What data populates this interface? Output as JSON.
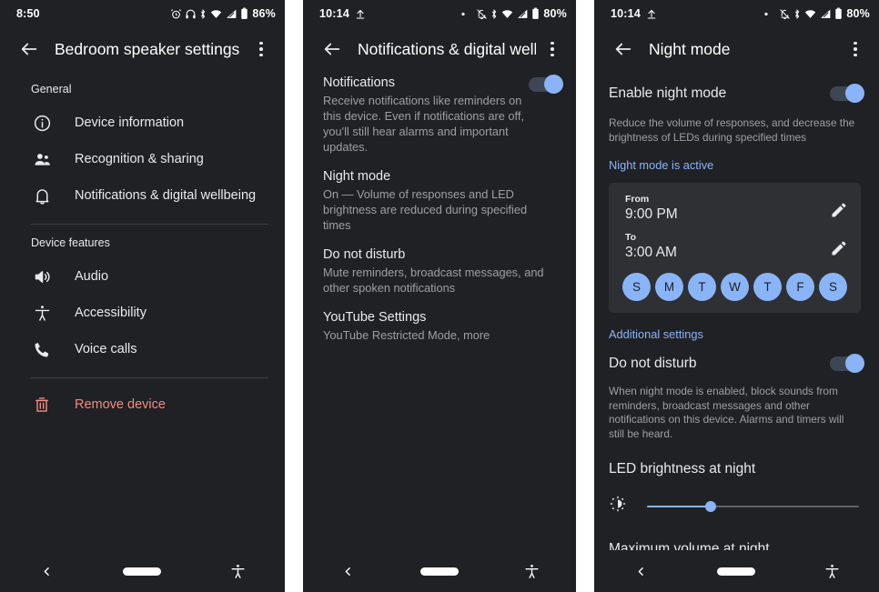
{
  "panels": [
    {
      "id": "bedroom-speaker-settings",
      "status": {
        "time": "8:50",
        "battery": "86%",
        "icons": [
          "alarm-icon",
          "headphones-icon",
          "bluetooth-icon",
          "wifi-icon",
          "signal-icon",
          "battery-icon"
        ]
      },
      "app_bar": {
        "back": "back-arrow-icon",
        "title": "Bedroom speaker settings",
        "overflow": "overflow-menu-icon"
      },
      "sections": [
        {
          "header": "General",
          "items": [
            {
              "icon": "info-circle-icon",
              "label": "Device information"
            },
            {
              "icon": "people-icon",
              "label": "Recognition & sharing"
            },
            {
              "icon": "bell-icon",
              "label": "Notifications & digital wellbeing"
            }
          ]
        },
        {
          "header": "Device features",
          "items": [
            {
              "icon": "speaker-volume-icon",
              "label": "Audio"
            },
            {
              "icon": "accessibility-icon",
              "label": "Accessibility"
            },
            {
              "icon": "phone-icon",
              "label": "Voice calls"
            }
          ]
        }
      ],
      "danger_item": {
        "icon": "trash-icon",
        "label": "Remove device"
      },
      "nav": {
        "back": "nav-back-icon",
        "home": "nav-home-pill",
        "accessibility": "nav-accessibility-icon"
      }
    },
    {
      "id": "notifications-digital-wellbeing",
      "status": {
        "time": "10:14",
        "battery": "80%",
        "icons": [
          "upload-icon",
          "dot-icon",
          "bell-off-icon",
          "bluetooth-icon",
          "wifi-icon",
          "signal-icon",
          "battery-icon"
        ]
      },
      "app_bar": {
        "back": "back-arrow-icon",
        "title": "Notifications & digital well...",
        "overflow": "overflow-menu-icon"
      },
      "prefs": [
        {
          "title": "Notifications",
          "sub": "Receive notifications like reminders on this device. Even if notifications are off, you'll still hear alarms and important updates.",
          "toggle": true
        },
        {
          "title": "Night mode",
          "sub": "On — Volume of responses and LED brightness are reduced during specified times",
          "toggle": false
        },
        {
          "title": "Do not disturb",
          "sub": "Mute reminders, broadcast messages, and other spoken notifications",
          "toggle": false
        },
        {
          "title": "YouTube Settings",
          "sub": "YouTube Restricted Mode, more",
          "toggle": false
        }
      ],
      "nav": {
        "back": "nav-back-icon",
        "home": "nav-home-pill",
        "accessibility": "nav-accessibility-icon"
      }
    },
    {
      "id": "night-mode",
      "status": {
        "time": "10:14",
        "battery": "80%",
        "icons": [
          "upload-icon",
          "dot-icon",
          "bell-off-icon",
          "bluetooth-icon",
          "wifi-icon",
          "signal-icon",
          "battery-icon"
        ]
      },
      "app_bar": {
        "back": "back-arrow-icon",
        "title": "Night mode",
        "overflow": "overflow-menu-icon"
      },
      "enable": {
        "label": "Enable night mode",
        "toggle": true
      },
      "description": "Reduce the volume of responses, and decrease the brightness of LEDs during specified times",
      "status_link": "Night mode is active",
      "schedule": {
        "from_caption": "From",
        "from_value": "9:00 PM",
        "to_caption": "To",
        "to_value": "3:00 AM",
        "edit_icon": "pencil-edit-icon",
        "days": [
          {
            "letter": "S",
            "selected": true
          },
          {
            "letter": "M",
            "selected": true
          },
          {
            "letter": "T",
            "selected": true
          },
          {
            "letter": "W",
            "selected": true
          },
          {
            "letter": "T",
            "selected": true
          },
          {
            "letter": "F",
            "selected": true
          },
          {
            "letter": "S",
            "selected": true
          }
        ]
      },
      "additional_link": "Additional settings",
      "dnd": {
        "label": "Do not disturb",
        "toggle": true,
        "description": "When night mode is enabled, block sounds from reminders, broadcast messages and other notifications on this device. Alarms and timers will still be heard."
      },
      "led": {
        "label": "LED brightness at night",
        "icon": "brightness-icon",
        "value_percent": 30
      },
      "max_volume_label": "Maximum volume at night",
      "nav": {
        "back": "nav-back-icon",
        "home": "nav-home-pill",
        "accessibility": "nav-accessibility-icon"
      }
    }
  ],
  "colors": {
    "background": "#202124",
    "accent": "#8ab4f8",
    "danger": "#f28b82",
    "card": "#2e3033",
    "secondary_text": "#9aa0a6"
  }
}
